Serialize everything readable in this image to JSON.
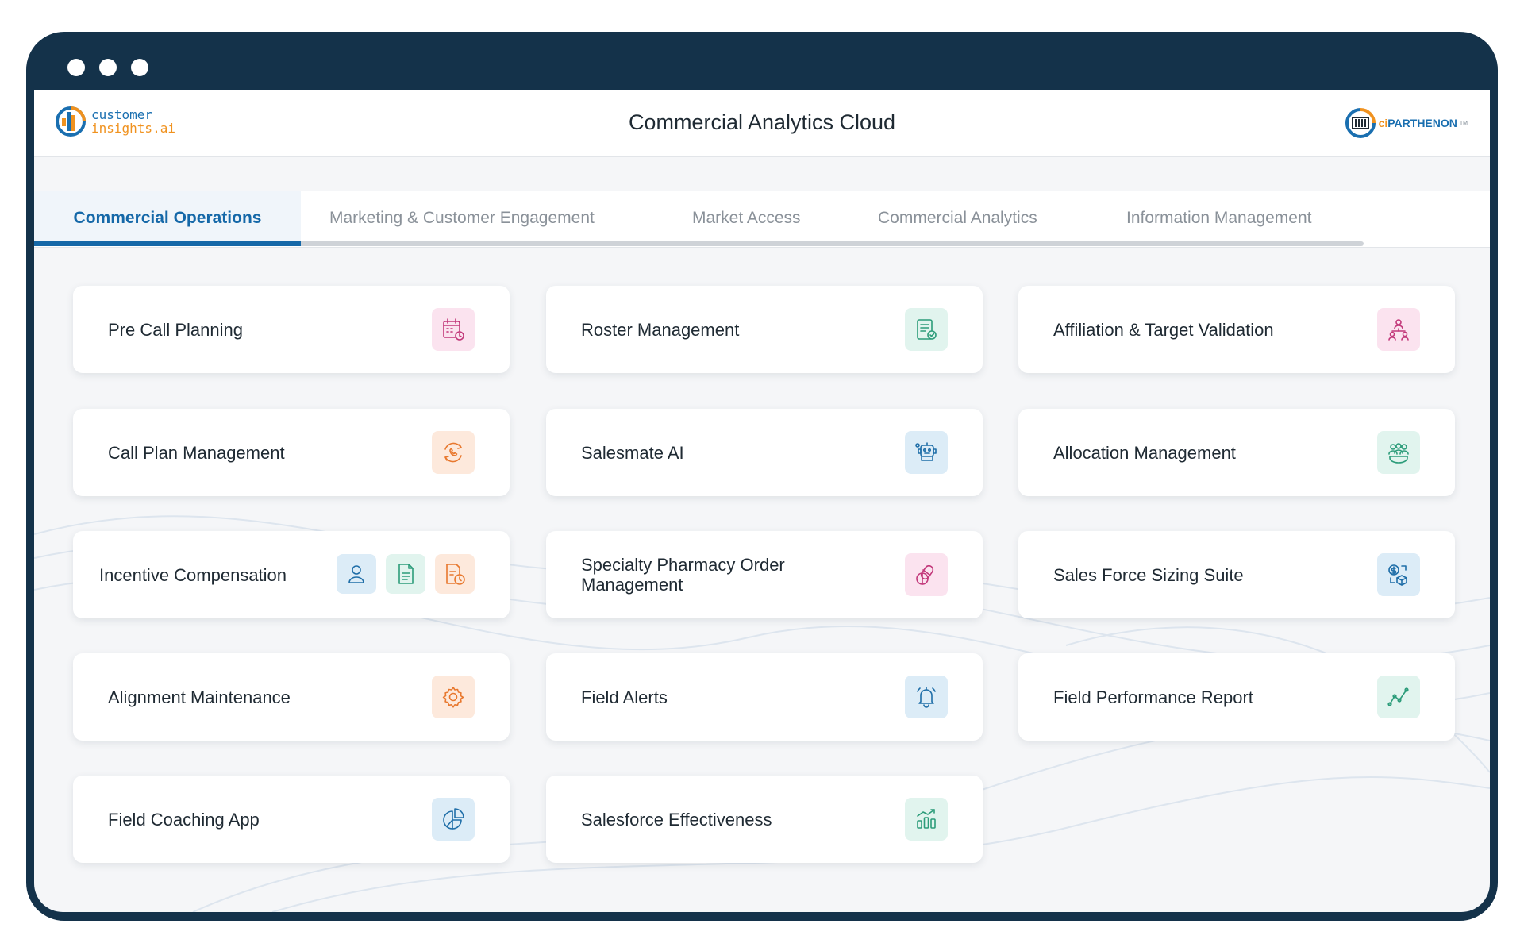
{
  "header": {
    "logo_left_line1": "customer",
    "logo_left_line2": "insights.ai",
    "title": "Commercial Analytics Cloud",
    "logo_right_prefix": "ci",
    "logo_right_name": "PARTHENON",
    "logo_right_tm": "TM"
  },
  "tabs": [
    {
      "label": "Commercial Operations",
      "active": true
    },
    {
      "label": "Marketing & Customer Engagement",
      "active": false
    },
    {
      "label": "Market Access",
      "active": false
    },
    {
      "label": "Commercial Analytics",
      "active": false
    },
    {
      "label": "Information Management",
      "active": false
    }
  ],
  "cards": [
    {
      "label": "Pre Call Planning",
      "icon": "calendar-clock-icon",
      "color": "#c2387a"
    },
    {
      "label": "Roster Management",
      "icon": "document-check-icon",
      "color": "#2c9c7a"
    },
    {
      "label": "Affiliation & Target Validation",
      "icon": "hierarchy-users-icon",
      "color": "#c2387a"
    },
    {
      "label": "Call Plan Management",
      "icon": "phone-cycle-icon",
      "color": "#e8782e"
    },
    {
      "label": "Salesmate AI",
      "icon": "robot-icon",
      "color": "#1f6ea8"
    },
    {
      "label": "Allocation Management",
      "icon": "group-users-icon",
      "color": "#2c9c7a"
    },
    {
      "label": "Incentive Compensation",
      "icons": [
        "user-icon",
        "document-icon",
        "document-clock-icon"
      ]
    },
    {
      "label": "Specialty Pharmacy Order Management",
      "icon": "pills-icon",
      "color": "#c2387a"
    },
    {
      "label": "Sales Force Sizing Suite",
      "icon": "dollar-cube-icon",
      "color": "#1f6ea8"
    },
    {
      "label": "Alignment Maintenance",
      "icon": "gear-wrench-icon",
      "color": "#e8782e"
    },
    {
      "label": "Field Alerts",
      "icon": "bell-icon",
      "color": "#1f6ea8"
    },
    {
      "label": "Field Performance Report",
      "icon": "line-chart-icon",
      "color": "#2c9c7a"
    },
    {
      "label": "Field Coaching App",
      "icon": "pie-chart-icon",
      "color": "#1f6ea8"
    },
    {
      "label": "Salesforce Effectiveness",
      "icon": "bar-chart-icon",
      "color": "#2c9c7a"
    }
  ]
}
